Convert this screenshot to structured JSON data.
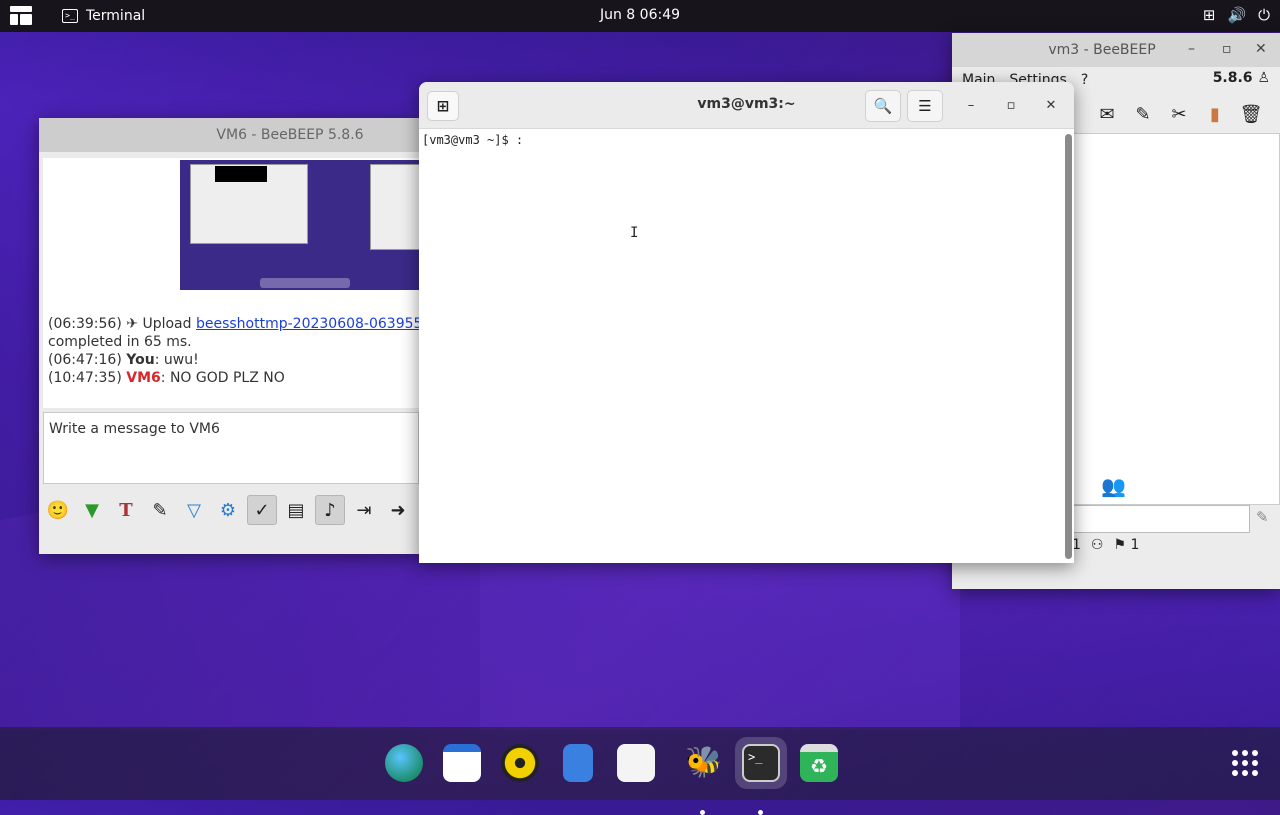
{
  "topbar": {
    "app_name": "Terminal",
    "clock": "Jun 8  06:49"
  },
  "vm6_window": {
    "title": "VM6 - BeeBEEP 5.8.6",
    "messages": {
      "m1_time": "(06:39:56)",
      "m1_text": " Upload ",
      "m1_link": "beesshottmp-20230608-063955.",
      "m1_cont": "completed in 65 ms.",
      "m2_time": "(06:47:16) ",
      "m2_user": "You",
      "m2_text": ": uwu!",
      "m3_time": "(10:47:35) ",
      "m3_user": "VM6",
      "m3_text": ": NO GOD PLZ NO"
    },
    "input_placeholder": "Write a message to VM6"
  },
  "vm3_window": {
    "title": "vm3 - BeeBEEP",
    "menu": [
      "Main",
      "Settings",
      "?"
    ],
    "version": "5.8.6",
    "status": [
      "1",
      "1"
    ]
  },
  "terminal": {
    "title": "vm3@vm3:~",
    "prompt": "[vm3@vm3 ~]$ :"
  }
}
